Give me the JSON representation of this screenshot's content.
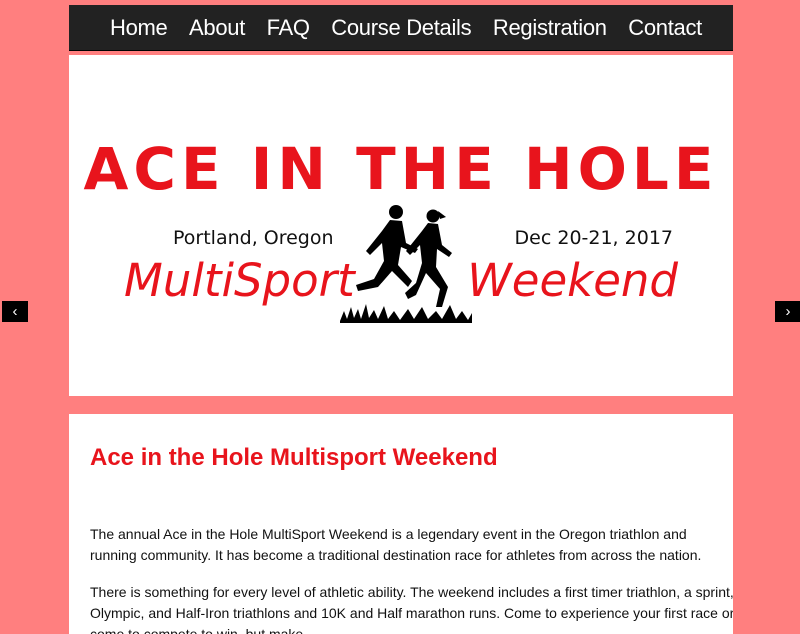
{
  "nav": {
    "items": [
      "Home",
      "About",
      "FAQ",
      "Course Details",
      "Registration",
      "Contact"
    ]
  },
  "hero": {
    "title": "ACE IN THE HOLE",
    "location": "Portland, Oregon",
    "date": "Dec 20-21, 2017",
    "multisport": "MultiSport",
    "weekend": "Weekend"
  },
  "carousel": {
    "prev_label": "‹",
    "next_label": "›"
  },
  "content": {
    "heading": "Ace in the Hole Multisport Weekend",
    "paragraph1": "The annual Ace in the Hole MultiSport Weekend is a legendary event in the Oregon triathlon and running community. It has become a traditional destination race for athletes from across the nation.",
    "paragraph2": "There is something for every level of athletic ability. The weekend includes a first timer triathlon, a sprint, Olympic, and Half-Iron triathlons and 10K and Half marathon runs. Come to experience your first race or come to compete to win, but make"
  },
  "colors": {
    "background": "#ff7f7f",
    "nav": "#222222",
    "accent_red": "#e8141c"
  }
}
